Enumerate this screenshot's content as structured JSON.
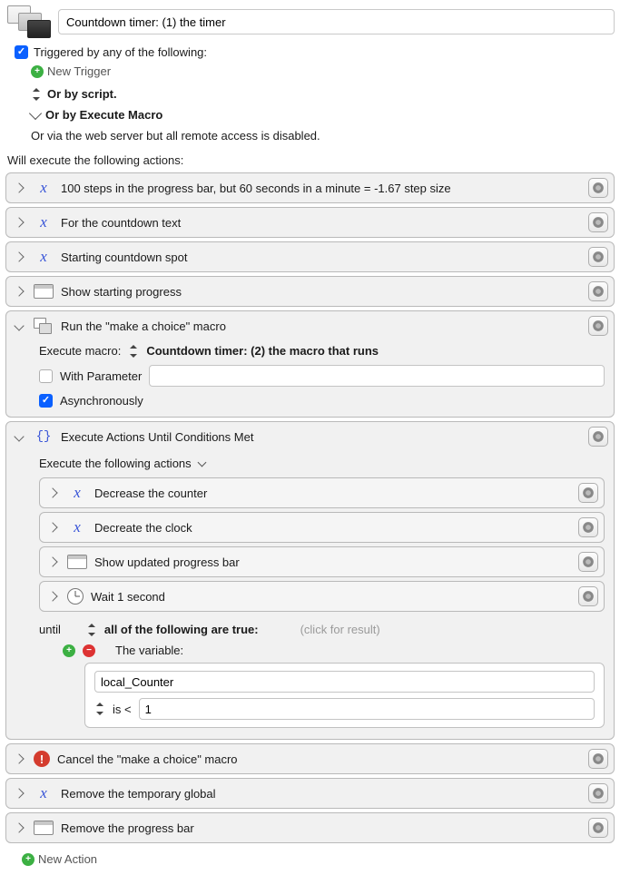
{
  "title": "Countdown timer: (1) the timer",
  "trigger": {
    "checked": true,
    "label": "Triggered by any of the following:",
    "new_trigger": "New Trigger",
    "or_script": "Or by script.",
    "or_execute": "Or by Execute Macro",
    "web_server": "Or via the web server but all remote access is disabled."
  },
  "will_execute": "Will execute the following actions:",
  "actions": {
    "a0": "100 steps in the progress bar, but 60 seconds in a minute = -1.67 step size",
    "a1": "For the countdown text",
    "a2": "Starting countdown spot",
    "a3": "Show starting progress",
    "a4": {
      "title": "Run the \"make a choice\" macro",
      "exec_label": "Execute macro:",
      "exec_target": "Countdown timer: (2) the macro that runs",
      "with_param": "With Parameter",
      "with_param_checked": false,
      "param_value": "",
      "async": "Asynchronously",
      "async_checked": true
    },
    "a5": {
      "title": "Execute Actions Until Conditions Met",
      "sub_label": "Execute the following actions",
      "nested": {
        "n0": "Decrease the counter",
        "n1": "Decreate the clock",
        "n2": "Show updated progress bar",
        "n3": "Wait 1 second"
      },
      "until": "until",
      "until_mode": "all of the following are true:",
      "click_result": "(click for result)",
      "var_label": "The variable:",
      "var_name": "local_Counter",
      "op": "is <",
      "op_value": "1"
    },
    "a6": "Cancel the \"make a choice\" macro",
    "a7": "Remove the temporary global",
    "a8": "Remove the progress bar"
  },
  "new_action": "New Action"
}
